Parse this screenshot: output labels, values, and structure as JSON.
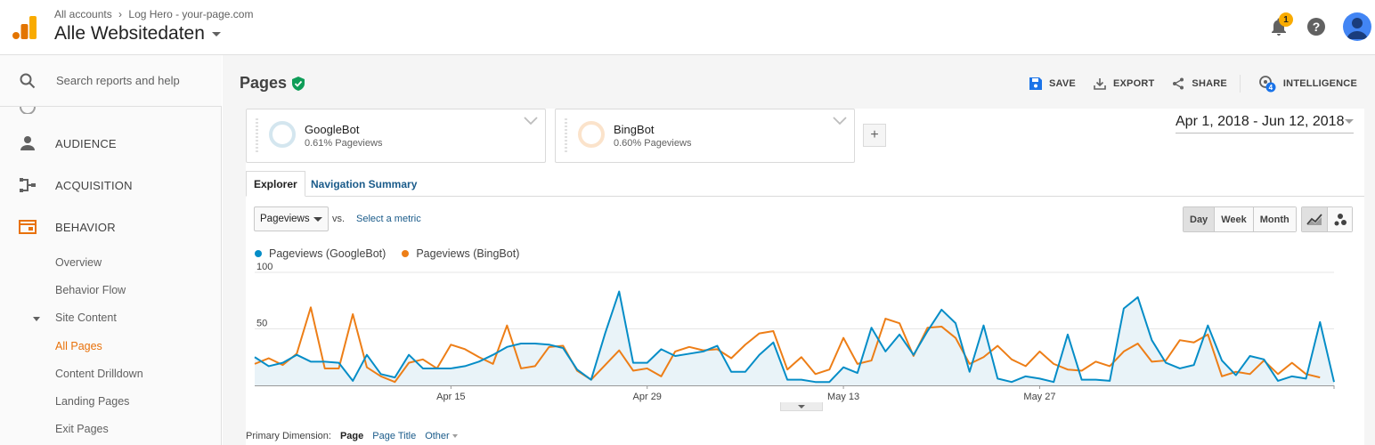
{
  "header": {
    "breadcrumb": [
      "All accounts",
      "Log Hero - your-page.com"
    ],
    "breadcrumb_sep": "›",
    "property_view": "Alle Websitedaten",
    "notification_count": "1",
    "help_glyph": "?",
    "icons": {
      "logo": "analytics-logo-icon",
      "bell": "bell-icon",
      "help": "help-icon",
      "avatar": "avatar"
    }
  },
  "sidebar": {
    "search_placeholder": "Search reports and help",
    "items": [
      {
        "label": "AUDIENCE",
        "icon": "person-icon"
      },
      {
        "label": "ACQUISITION",
        "icon": "acquisition-icon"
      },
      {
        "label": "BEHAVIOR",
        "icon": "behavior-icon",
        "color": "#e8710a"
      }
    ],
    "behavior_sub": [
      "Overview",
      "Behavior Flow"
    ],
    "site_content_label": "Site Content",
    "site_content_sub": [
      "All Pages",
      "Content Drilldown",
      "Landing Pages",
      "Exit Pages"
    ],
    "active_item": "All Pages"
  },
  "main": {
    "page_title": "Pages",
    "actions": [
      "SAVE",
      "EXPORT",
      "SHARE",
      "INTELLIGENCE"
    ],
    "intelligence_badge": "4",
    "segments": [
      {
        "name": "GoogleBot",
        "sub": "0.61% Pageviews",
        "color": "#d4e6ef"
      },
      {
        "name": "BingBot",
        "sub": "0.60% Pageviews",
        "color": "#fbe3cb"
      }
    ],
    "add_segment": "+",
    "date_range": "Apr 1, 2018 - Jun 12, 2018",
    "tabs": [
      "Explorer",
      "Navigation Summary"
    ],
    "metric": "Pageviews",
    "vs": "vs.",
    "select_metric": "Select a metric",
    "granularity": [
      "Day",
      "Week",
      "Month"
    ],
    "granularity_selected": "Day",
    "primary_dimension_label": "Primary Dimension:",
    "primary_dimension_current": "Page",
    "primary_dimension_links": [
      "Page Title",
      "Other"
    ]
  },
  "chart_data": {
    "type": "line",
    "y_ticks": [
      100,
      50
    ],
    "ylim": [
      0,
      100
    ],
    "x_ticks": [
      "Apr 15",
      "Apr 29",
      "May 13",
      "May 27"
    ],
    "x_tick_index": [
      14,
      28,
      42,
      56
    ],
    "series": [
      {
        "name": "Pageviews (GoogleBot)",
        "color": "#058dc7",
        "fill": "#e9f3f8",
        "values": [
          25,
          17,
          20,
          27,
          21,
          21,
          20,
          4,
          27,
          10,
          7,
          27,
          15,
          15,
          15,
          17,
          21,
          27,
          34,
          37,
          37,
          36,
          33,
          14,
          5,
          46,
          83,
          20,
          20,
          32,
          26,
          28,
          30,
          35,
          12,
          12,
          27,
          38,
          5,
          5,
          3,
          3,
          16,
          11,
          51,
          30,
          45,
          27,
          48,
          67,
          55,
          12,
          53,
          6,
          3,
          8,
          6,
          3,
          45,
          5,
          5,
          4,
          68,
          78,
          40,
          20,
          15,
          18,
          53,
          22,
          9,
          26,
          23,
          4,
          8,
          6,
          56,
          3
        ]
      },
      {
        "name": "Pageviews (BingBot)",
        "color": "#ed7e17",
        "values": [
          19,
          24,
          18,
          28,
          69,
          15,
          15,
          63,
          16,
          8,
          3,
          20,
          23,
          15,
          36,
          32,
          25,
          19,
          53,
          15,
          17,
          34,
          35,
          13,
          5,
          18,
          31,
          13,
          15,
          8,
          30,
          34,
          31,
          32,
          24,
          36,
          46,
          48,
          14,
          25,
          10,
          14,
          42,
          19,
          22,
          59,
          55,
          26,
          51,
          52,
          42,
          19,
          25,
          35,
          23,
          17,
          30,
          19,
          14,
          13,
          21,
          17,
          30,
          37,
          21,
          22,
          40,
          38,
          45,
          8,
          12,
          10,
          22,
          10,
          20,
          10,
          7
        ]
      }
    ]
  }
}
